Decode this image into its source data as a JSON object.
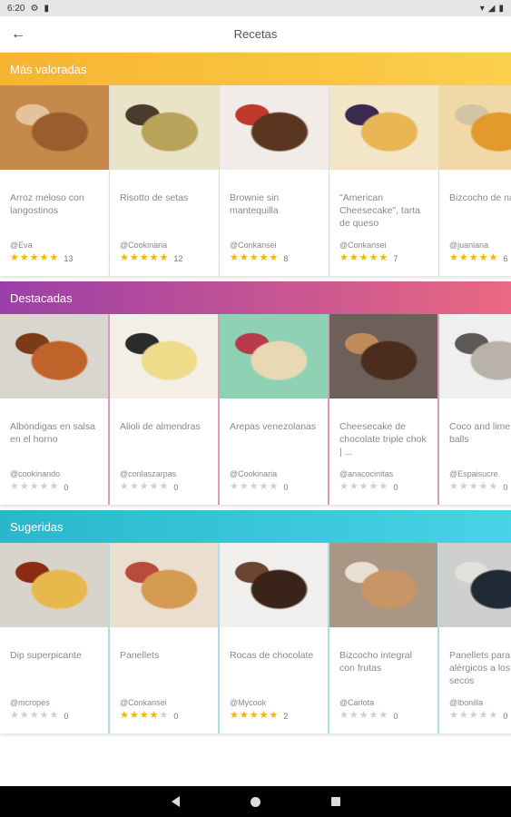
{
  "status": {
    "time": "6:20",
    "icons": [
      "settings-icon",
      "sim-icon",
      "wifi-icon",
      "signal-icon",
      "battery-icon"
    ]
  },
  "app_bar": {
    "title": "Recetas",
    "back_icon": "arrow-left-icon"
  },
  "sections": [
    {
      "title": "Más valoradas",
      "cards": [
        {
          "title": "Arroz meloso con langostinos",
          "author": "@Eva",
          "stars": 5,
          "count": "13",
          "colors": [
            "#c58a4a",
            "#9a5d2e",
            "#e4c39c"
          ]
        },
        {
          "title": "Risotto de setas",
          "author": "@Cookinaria",
          "stars": 5,
          "count": "12",
          "colors": [
            "#e9e3c8",
            "#b9a25a",
            "#4a3b2f"
          ]
        },
        {
          "title": "Brownie sin mantequilla",
          "author": "@Conkansei",
          "stars": 5,
          "count": "8",
          "colors": [
            "#f1ece7",
            "#5a3520",
            "#c0392b"
          ]
        },
        {
          "title": "\"American Cheesecake\", tarta de queso",
          "author": "@Conkansei",
          "stars": 5,
          "count": "7",
          "colors": [
            "#f3e6c7",
            "#e8b655",
            "#3a2a4f"
          ]
        },
        {
          "title": "Bizcocho de naranja",
          "author": "@juaniana",
          "stars": 5,
          "count": "6",
          "colors": [
            "#f0d9a6",
            "#e39a2d",
            "#d2c4a4"
          ]
        }
      ]
    },
    {
      "title": "Destacadas",
      "cards": [
        {
          "title": "Albóndigas en salsa en el horno",
          "author": "@cookinando",
          "stars": 0,
          "count": "0",
          "colors": [
            "#d9d5cf",
            "#c0632a",
            "#7b3b17"
          ]
        },
        {
          "title": "Alioli de almendras",
          "author": "@conlaszarpas",
          "stars": 0,
          "count": "0",
          "colors": [
            "#f4efe4",
            "#eddc8a",
            "#2b2b2b"
          ]
        },
        {
          "title": "Arepas venezolanas",
          "author": "@Cookinaria",
          "stars": 0,
          "count": "0",
          "colors": [
            "#8fd1b4",
            "#e8d9b4",
            "#b83a4b"
          ]
        },
        {
          "title": "Cheesecake de chocolate triple chok | ...",
          "author": "@anacocinitas",
          "stars": 0,
          "count": "0",
          "colors": [
            "#6d6058",
            "#4b2c1d",
            "#c08a5a"
          ]
        },
        {
          "title": "Coco and lime raw balls",
          "author": "@Espaisucre",
          "stars": 0,
          "count": "0",
          "colors": [
            "#efefef",
            "#b9b2a8",
            "#5d5a55"
          ]
        }
      ]
    },
    {
      "title": "Sugeridas",
      "cards": [
        {
          "title": "Dip superpicante",
          "author": "@mcropes",
          "stars": 0,
          "count": "0",
          "colors": [
            "#d8d4cc",
            "#e7b84b",
            "#8a2b14"
          ]
        },
        {
          "title": "Panellets",
          "author": "@Conkansei",
          "stars": 4,
          "count": "0",
          "colors": [
            "#eadfcf",
            "#d59a52",
            "#b84b3a"
          ]
        },
        {
          "title": "Rocas de chocolate",
          "author": "@Mycook",
          "stars": 5,
          "count": "2",
          "colors": [
            "#f0efee",
            "#3a2419",
            "#6b4432"
          ]
        },
        {
          "title": "Bizcocho integral con frutas",
          "author": "@Carlota",
          "stars": 0,
          "count": "0",
          "colors": [
            "#a99684",
            "#c89566",
            "#e8ded2"
          ]
        },
        {
          "title": "Panellets para alérgicos a los frutos secos",
          "author": "@lbonilla",
          "stars": 0,
          "count": "0",
          "colors": [
            "#cfcfcf",
            "#1f2a36",
            "#e2e0da"
          ]
        }
      ]
    }
  ],
  "nav_bar": {
    "icons": [
      "nav-back-icon",
      "nav-home-icon",
      "nav-recents-icon"
    ]
  }
}
